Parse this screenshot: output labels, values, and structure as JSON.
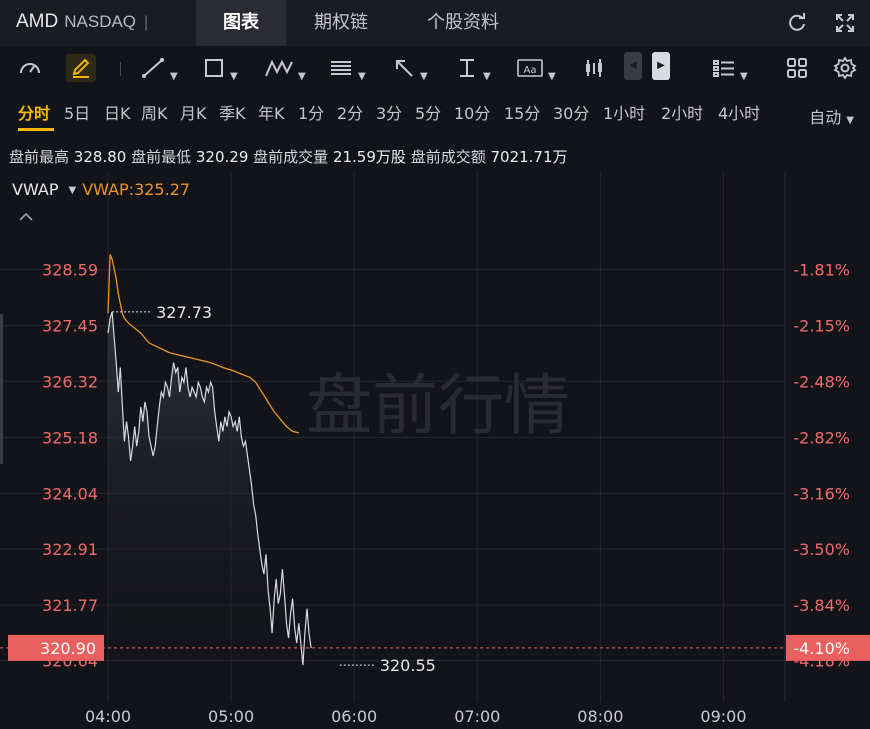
{
  "header": {
    "symbol": "AMD",
    "exchange": "NASDAQ",
    "separator": "|",
    "tabs": [
      "图表",
      "期权链",
      "个股资料"
    ],
    "active_tab": "图表"
  },
  "toolbar": {
    "icons": [
      "gauge-icon",
      "pen-icon",
      "line-tool-icon",
      "rect-tool-icon",
      "pattern-tool-icon",
      "fib-tool-icon",
      "arrow-tool-icon",
      "measure-tool-icon",
      "text-tool-icon",
      "candle-type-icon",
      "prev-icon",
      "next-icon",
      "indicator-list-icon",
      "grid-layout-icon",
      "settings-icon"
    ]
  },
  "periods": {
    "items": [
      "分时",
      "5日",
      "日K",
      "周K",
      "月K",
      "季K",
      "年K",
      "1分",
      "2分",
      "3分",
      "5分",
      "10分",
      "15分",
      "30分",
      "1小时",
      "2小时",
      "4小时"
    ],
    "active": "分时",
    "mode": "自动"
  },
  "stats": {
    "high_label": "盘前最高",
    "high_value": "328.80",
    "low_label": "盘前最低",
    "low_value": "320.29",
    "vol_label": "盘前成交量",
    "vol_value": "21.59万股",
    "amt_label": "盘前成交额",
    "amt_value": "7021.71万"
  },
  "indicator": {
    "name": "VWAP",
    "label": "VWAP:325.27"
  },
  "watermark": "盘前行情",
  "colors": {
    "price_axis": "#f06a6a",
    "vwap": "#e8952a",
    "price_line": "#d9dbe0",
    "current_tag": "#e9605f",
    "accent": "#f5b800"
  },
  "chart_data": {
    "type": "line",
    "title": "",
    "x_ticks": [
      "04:00",
      "05:00",
      "06:00",
      "07:00",
      "08:00",
      "09:00"
    ],
    "x_range_minutes": [
      240,
      570
    ],
    "y_ticks": [
      "328.59",
      "327.45",
      "326.32",
      "325.18",
      "324.04",
      "322.91",
      "321.77",
      "320.64"
    ],
    "pct_ticks": [
      "-1.81%",
      "-2.15%",
      "-2.48%",
      "-2.82%",
      "-3.16%",
      "-3.50%",
      "-3.84%",
      "-4.18%"
    ],
    "ylim": [
      319.8,
      329.7
    ],
    "current_price": "320.90",
    "current_pct": "-4.10%",
    "high_label": "327.73",
    "low_label": "320.55",
    "high_marker": {
      "t": 242,
      "v": 327.73
    },
    "low_marker": {
      "t": 353,
      "v": 320.55
    },
    "current_value": 320.9,
    "series": [
      {
        "name": "price",
        "points": [
          [
            240,
            327.3
          ],
          [
            241,
            327.6
          ],
          [
            242,
            327.73
          ],
          [
            243,
            327.2
          ],
          [
            244,
            326.7
          ],
          [
            245,
            326.1
          ],
          [
            246,
            326.6
          ],
          [
            247,
            325.8
          ],
          [
            248,
            325.1
          ],
          [
            249,
            325.5
          ],
          [
            250,
            325.2
          ],
          [
            251,
            324.7
          ],
          [
            252,
            325.0
          ],
          [
            253,
            325.4
          ],
          [
            254,
            325.0
          ],
          [
            255,
            325.3
          ],
          [
            256,
            325.8
          ],
          [
            257,
            325.5
          ],
          [
            258,
            325.9
          ],
          [
            259,
            325.7
          ],
          [
            260,
            325.2
          ],
          [
            261,
            325.0
          ],
          [
            262,
            324.8
          ],
          [
            263,
            325.0
          ],
          [
            264,
            325.4
          ],
          [
            265,
            325.8
          ],
          [
            266,
            326.1
          ],
          [
            267,
            326.0
          ],
          [
            268,
            326.3
          ],
          [
            269,
            326.2
          ],
          [
            270,
            326.0
          ],
          [
            271,
            326.4
          ],
          [
            272,
            326.7
          ],
          [
            273,
            326.5
          ],
          [
            274,
            326.6
          ],
          [
            275,
            326.1
          ],
          [
            276,
            326.4
          ],
          [
            277,
            326.3
          ],
          [
            278,
            326.6
          ],
          [
            279,
            326.2
          ],
          [
            280,
            326.0
          ],
          [
            281,
            326.2
          ],
          [
            282,
            326.1
          ],
          [
            283,
            326.0
          ],
          [
            284,
            326.3
          ],
          [
            285,
            326.2
          ],
          [
            286,
            326.0
          ],
          [
            287,
            325.9
          ],
          [
            288,
            326.2
          ],
          [
            289,
            326.1
          ],
          [
            290,
            326.3
          ],
          [
            291,
            326.2
          ],
          [
            292,
            325.7
          ],
          [
            293,
            325.4
          ],
          [
            294,
            325.1
          ],
          [
            295,
            325.5
          ],
          [
            296,
            325.3
          ],
          [
            297,
            325.6
          ],
          [
            298,
            325.4
          ],
          [
            299,
            325.7
          ],
          [
            300,
            325.6
          ],
          [
            301,
            325.4
          ],
          [
            302,
            325.5
          ],
          [
            303,
            325.3
          ],
          [
            304,
            325.6
          ],
          [
            305,
            325.2
          ],
          [
            306,
            325.0
          ],
          [
            307,
            325.1
          ],
          [
            308,
            324.8
          ],
          [
            309,
            324.5
          ],
          [
            310,
            324.2
          ],
          [
            311,
            323.8
          ],
          [
            312,
            323.6
          ],
          [
            313,
            323.2
          ],
          [
            314,
            322.9
          ],
          [
            315,
            322.6
          ],
          [
            316,
            322.4
          ],
          [
            317,
            322.8
          ],
          [
            318,
            322.1
          ],
          [
            319,
            321.7
          ],
          [
            320,
            321.2
          ],
          [
            321,
            321.9
          ],
          [
            322,
            322.3
          ],
          [
            323,
            321.8
          ],
          [
            324,
            322.0
          ],
          [
            325,
            322.5
          ],
          [
            326,
            322.0
          ],
          [
            327,
            321.4
          ],
          [
            328,
            321.1
          ],
          [
            329,
            321.6
          ],
          [
            330,
            321.9
          ],
          [
            331,
            321.3
          ],
          [
            332,
            321.0
          ],
          [
            333,
            321.4
          ],
          [
            334,
            321.0
          ],
          [
            335,
            320.55
          ],
          [
            336,
            321.2
          ],
          [
            337,
            321.7
          ],
          [
            338,
            321.2
          ],
          [
            339,
            320.9
          ]
        ]
      },
      {
        "name": "VWAP",
        "points": [
          [
            240,
            327.7
          ],
          [
            241,
            328.9
          ],
          [
            242,
            328.8
          ],
          [
            243,
            328.6
          ],
          [
            244,
            328.4
          ],
          [
            245,
            328.1
          ],
          [
            246,
            327.9
          ],
          [
            247,
            327.7
          ],
          [
            248,
            327.6
          ],
          [
            250,
            327.5
          ],
          [
            253,
            327.4
          ],
          [
            256,
            327.3
          ],
          [
            260,
            327.1
          ],
          [
            265,
            327.0
          ],
          [
            270,
            326.9
          ],
          [
            275,
            326.85
          ],
          [
            280,
            326.8
          ],
          [
            285,
            326.75
          ],
          [
            290,
            326.7
          ],
          [
            293,
            326.65
          ],
          [
            296,
            326.6
          ],
          [
            300,
            326.55
          ],
          [
            303,
            326.5
          ],
          [
            306,
            326.45
          ],
          [
            309,
            326.4
          ],
          [
            312,
            326.3
          ],
          [
            315,
            326.1
          ],
          [
            318,
            325.9
          ],
          [
            321,
            325.7
          ],
          [
            324,
            325.55
          ],
          [
            327,
            325.4
          ],
          [
            330,
            325.3
          ],
          [
            333,
            325.27
          ]
        ]
      }
    ]
  }
}
